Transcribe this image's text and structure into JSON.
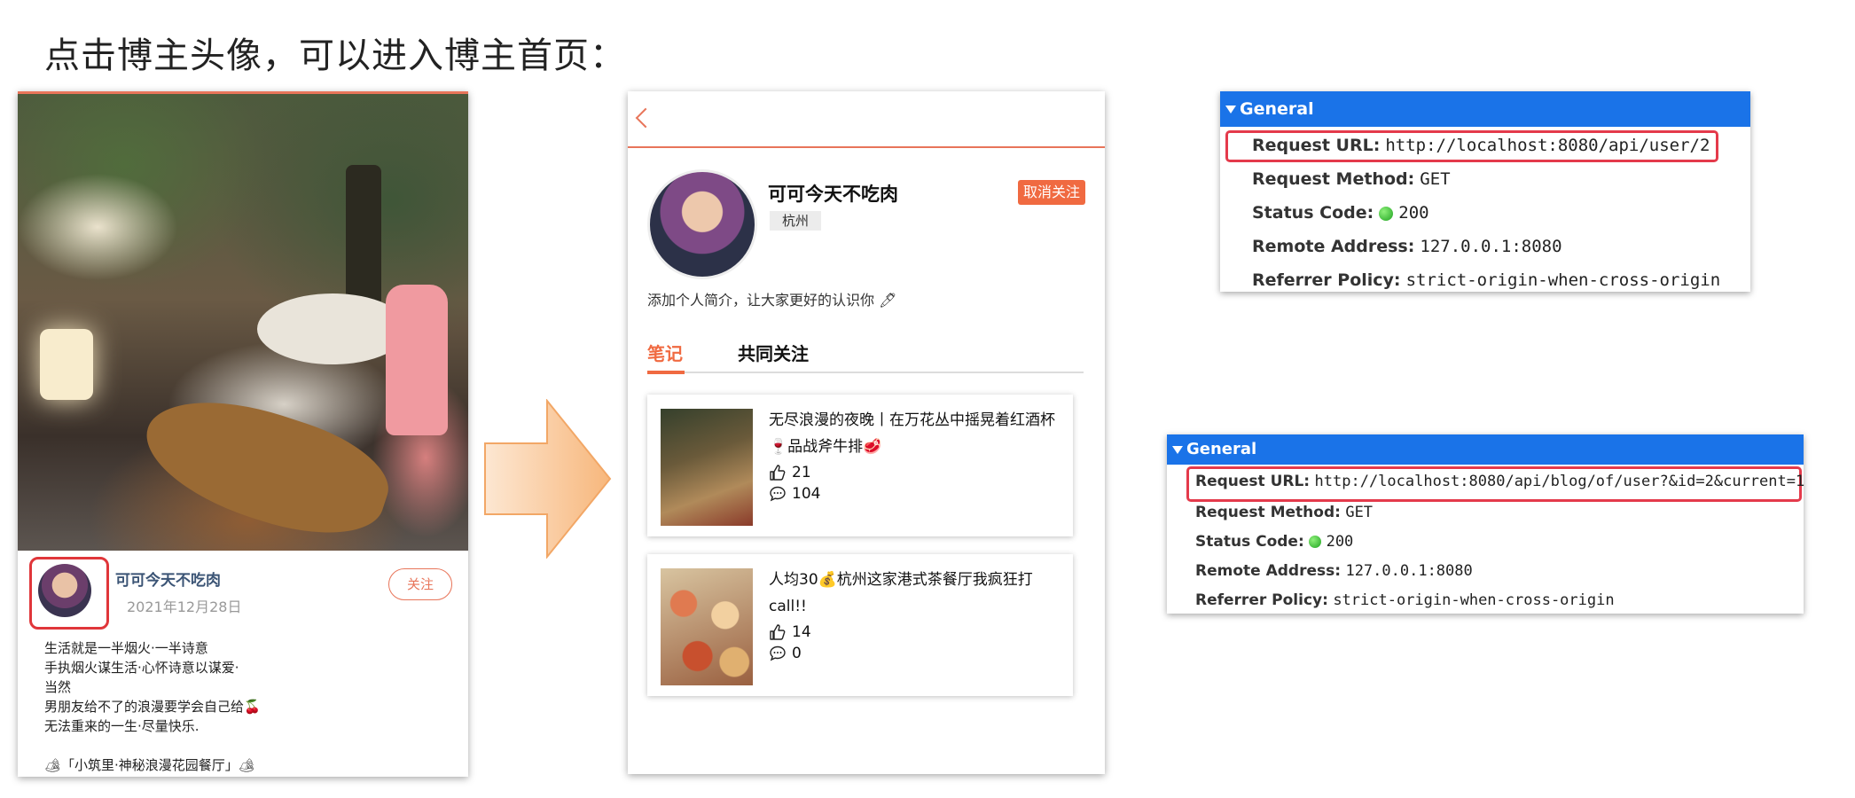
{
  "heading": "点击博主头像，可以进入博主首页：",
  "post_card": {
    "author_name": "可可今天不吃肉",
    "date": "2021年12月28日",
    "follow_label": "关注",
    "text_lines": [
      "生活就是一半烟火·一半诗意",
      "手执烟火谋生活·心怀诗意以谋爱·",
      "当然",
      "男朋友给不了的浪漫要学会自己给🍒",
      "无法重来的一生·尽量快乐."
    ],
    "footer_line": "🏕「小筑里·神秘浪漫花园餐厅」🏕"
  },
  "profile": {
    "name": "可可今天不吃肉",
    "city": "杭州",
    "unfollow_label": "取消关注",
    "bio": "添加个人简介，让大家更好的认识你 🖊",
    "tabs": [
      "笔记",
      "共同关注"
    ],
    "notes": [
      {
        "title": "无尽浪漫的夜晚丨在万花丛中摇晃着红酒杯🍷品战斧牛排🥩",
        "likes": "21",
        "comments": "104"
      },
      {
        "title": "人均30💰杭州这家港式茶餐厅我疯狂打call!!",
        "likes": "14",
        "comments": "0"
      }
    ]
  },
  "panel1": {
    "header": "General",
    "request_url_label": "Request URL:",
    "request_url": "http://localhost:8080/api/user/2",
    "method_label": "Request Method:",
    "method": "GET",
    "status_label": "Status Code:",
    "status": "200",
    "status_color": "#22a323",
    "remote_label": "Remote Address:",
    "remote": "127.0.0.1:8080",
    "referrer_label": "Referrer Policy:",
    "referrer": "strict-origin-when-cross-origin"
  },
  "panel2": {
    "header": "General",
    "request_url_label": "Request URL:",
    "request_url": "http://localhost:8080/api/blog/of/user?&id=2&current=1",
    "method_label": "Request Method:",
    "method": "GET",
    "status_label": "Status Code:",
    "status": "200",
    "remote_label": "Remote Address:",
    "remote": "127.0.0.1:8080",
    "referrer_label": "Referrer Policy:",
    "referrer": "strict-origin-when-cross-origin"
  },
  "colors": {
    "accent": "#f06a41",
    "highlight": "#e43a4b",
    "devtools_header": "#1a73e8"
  },
  "icons": [
    "back-chevron-icon",
    "thumbs-up-icon",
    "comment-icon",
    "disclosure-triangle-icon",
    "status-dot-icon",
    "right-arrow-graphic"
  ]
}
